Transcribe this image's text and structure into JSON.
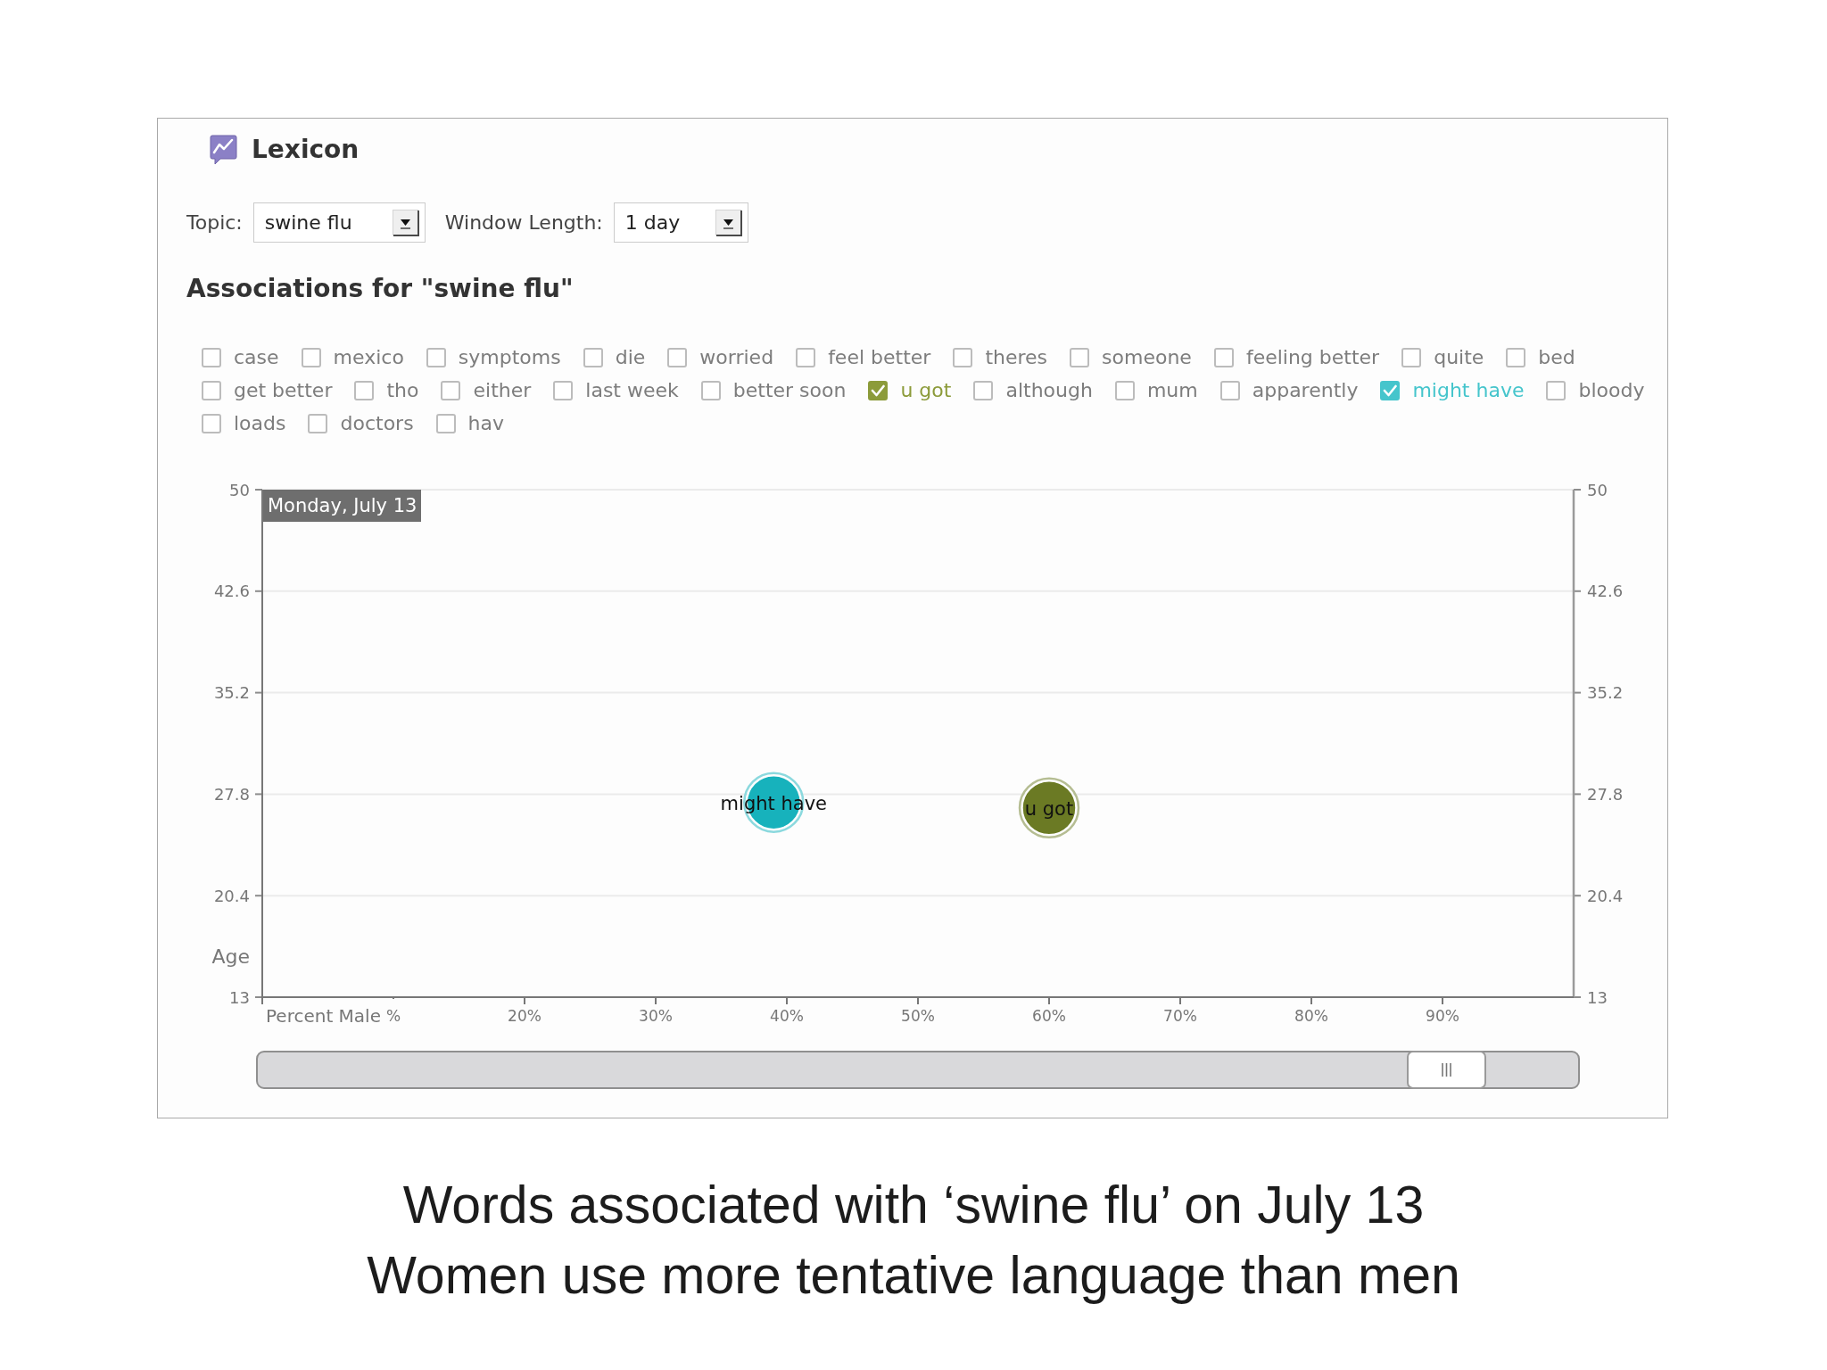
{
  "app": {
    "title": "Lexicon"
  },
  "filters": [
    {
      "label": "Topic:",
      "value": "swine flu"
    },
    {
      "label": "Window Length:",
      "value": "1 day"
    }
  ],
  "associations": {
    "title": "Associations for \"swine flu\"",
    "terms": [
      {
        "label": "case",
        "checked": false
      },
      {
        "label": "mexico",
        "checked": false
      },
      {
        "label": "symptoms",
        "checked": false
      },
      {
        "label": "die",
        "checked": false
      },
      {
        "label": "worried",
        "checked": false
      },
      {
        "label": "feel better",
        "checked": false
      },
      {
        "label": "theres",
        "checked": false
      },
      {
        "label": "someone",
        "checked": false
      },
      {
        "label": "feeling better",
        "checked": false
      },
      {
        "label": "quite",
        "checked": false
      },
      {
        "label": "bed",
        "checked": false
      },
      {
        "label": "get better",
        "checked": false
      },
      {
        "label": "tho",
        "checked": false
      },
      {
        "label": "either",
        "checked": false
      },
      {
        "label": "last week",
        "checked": false
      },
      {
        "label": "better soon",
        "checked": false
      },
      {
        "label": "u got",
        "checked": true,
        "color": "#8c9b3a"
      },
      {
        "label": "although",
        "checked": false
      },
      {
        "label": "mum",
        "checked": false
      },
      {
        "label": "apparently",
        "checked": false
      },
      {
        "label": "might have",
        "checked": true,
        "color": "#45c5cc"
      },
      {
        "label": "bloody",
        "checked": false
      },
      {
        "label": "loads",
        "checked": false
      },
      {
        "label": "doctors",
        "checked": false
      },
      {
        "label": "hav",
        "checked": false
      }
    ]
  },
  "chart": {
    "chart_data": {
      "type": "scatter",
      "xlabel": "Percent Male",
      "ylabel": "Age",
      "xlim": [
        0,
        100
      ],
      "ylim": [
        13,
        50
      ],
      "y2lim": [
        13,
        50
      ],
      "xticks": [
        {
          "value": 10,
          "label": "%"
        },
        {
          "value": 20,
          "label": "20%"
        },
        {
          "value": 30,
          "label": "30%"
        },
        {
          "value": 40,
          "label": "40%"
        },
        {
          "value": 50,
          "label": "50%"
        },
        {
          "value": 60,
          "label": "60%"
        },
        {
          "value": 70,
          "label": "70%"
        },
        {
          "value": 80,
          "label": "80%"
        },
        {
          "value": 90,
          "label": "90%"
        }
      ],
      "yticks": [
        13,
        20.4,
        27.8,
        35.2,
        42.6,
        50
      ],
      "y2ticks": [
        13,
        20.4,
        27.8,
        35.2,
        42.6,
        50
      ],
      "grid": "y",
      "annotations": [
        "Monday, July 13"
      ],
      "series": [
        {
          "name": "might have",
          "color": "#17b2bc",
          "x": [
            39
          ],
          "values": [
            27.2
          ]
        },
        {
          "name": "u got",
          "color": "#6b7a24",
          "x": [
            60
          ],
          "values": [
            26.8
          ]
        }
      ]
    }
  },
  "time_slider": {
    "level": 0.9
  },
  "caption": [
    "Words associated with ‘swine flu’ on July 13",
    "Women use more tentative language than men"
  ]
}
